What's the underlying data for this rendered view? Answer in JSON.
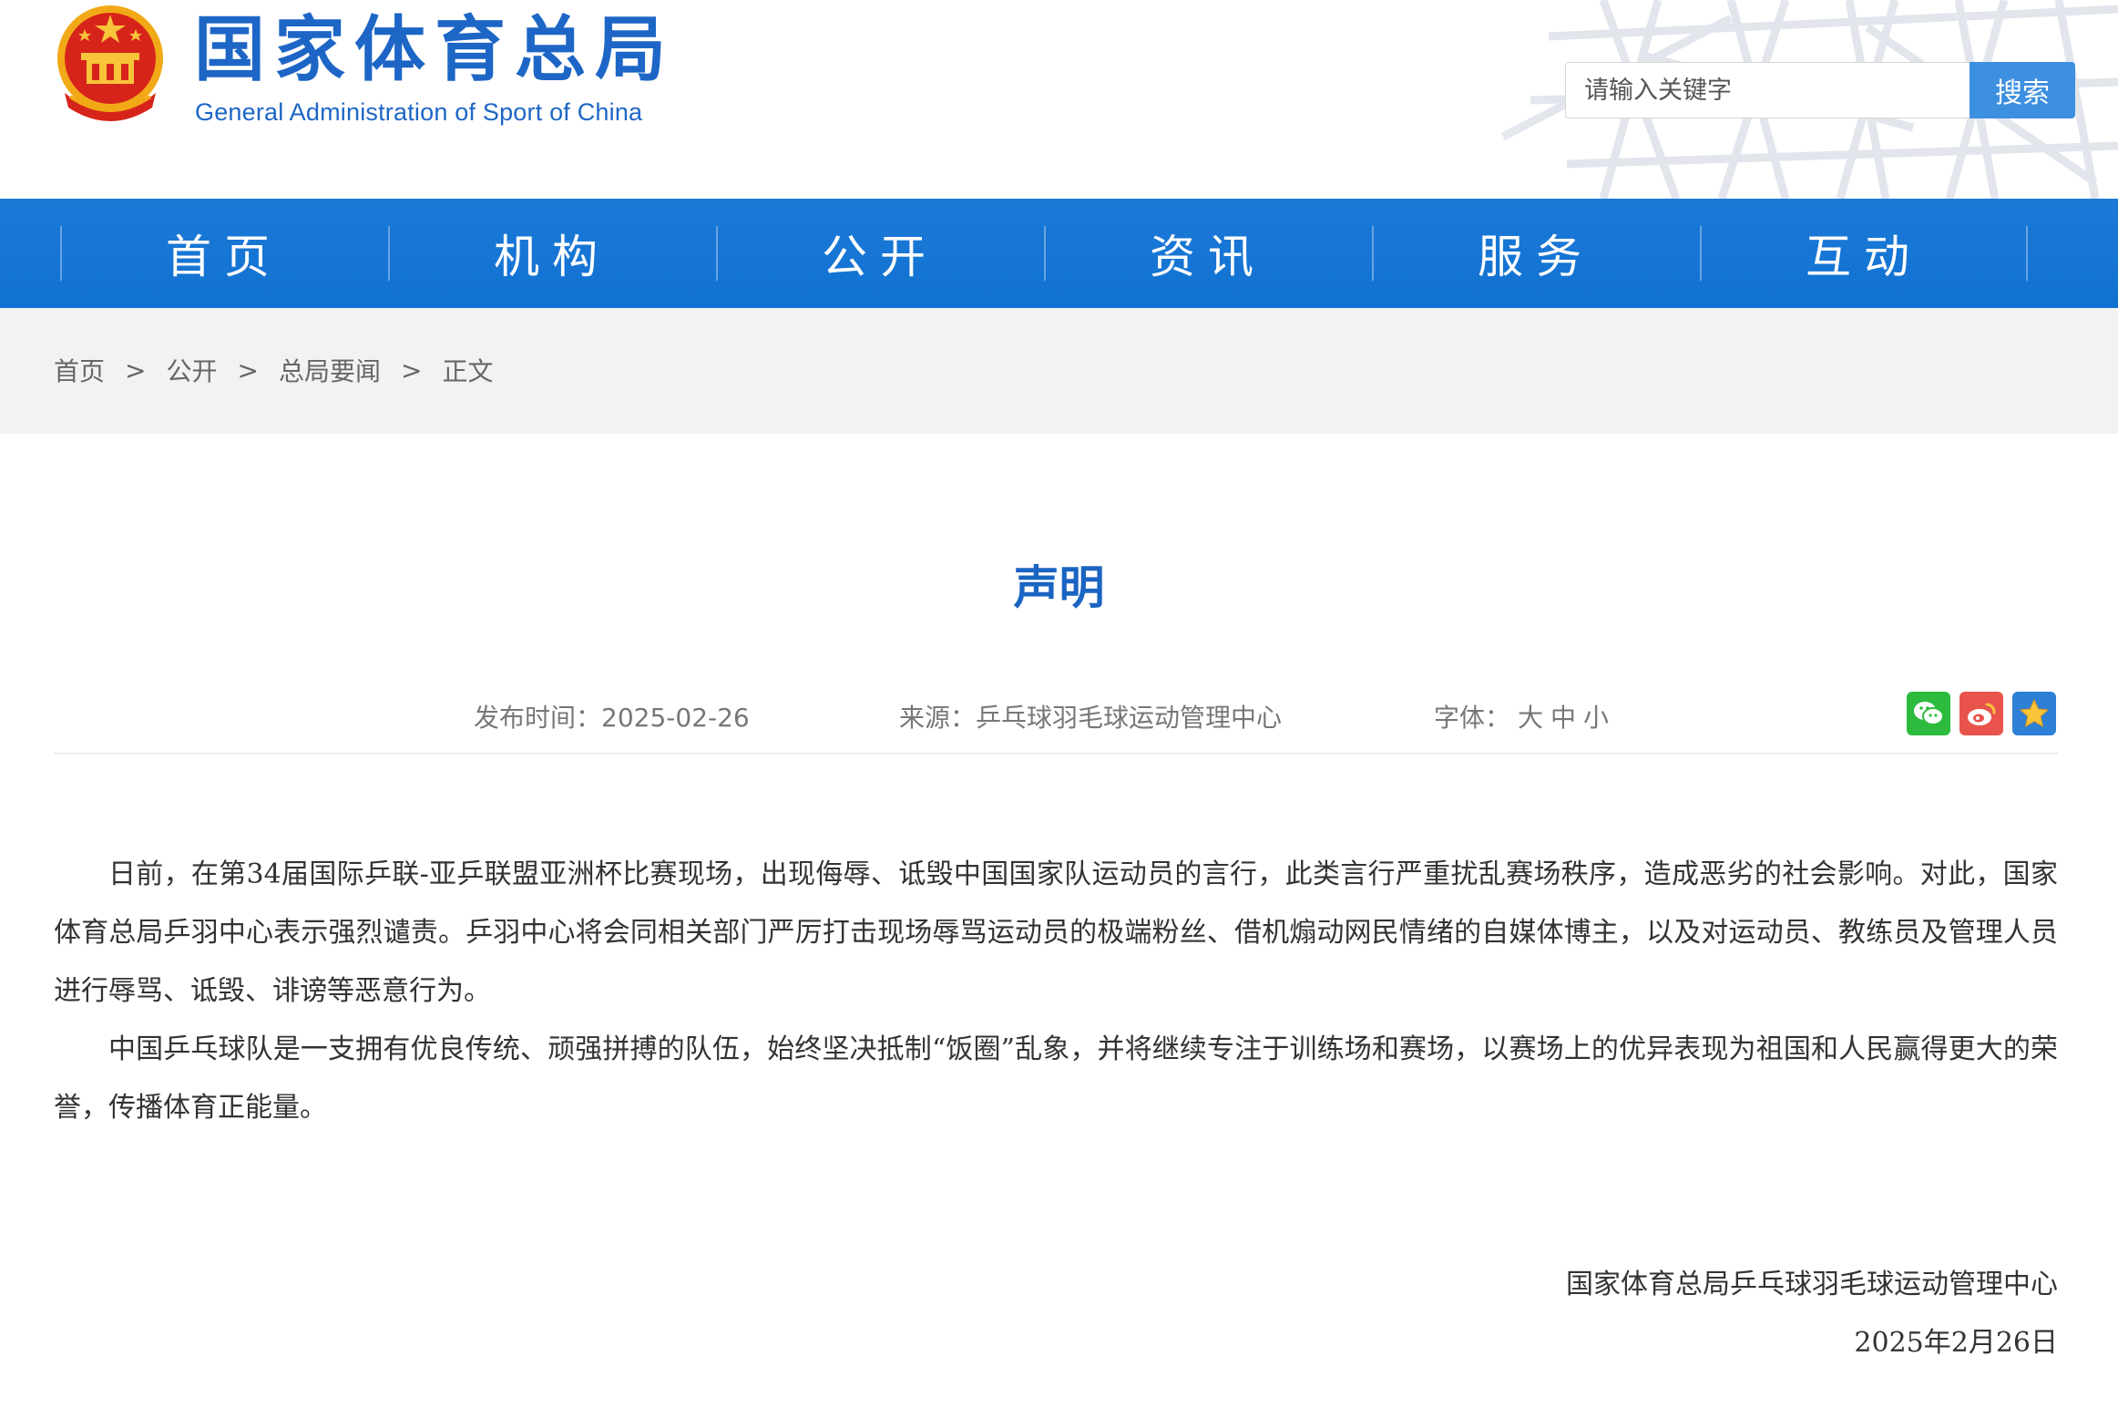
{
  "header": {
    "title": "国家体育总局",
    "subtitle": "General Administration of Sport of China",
    "emblem_icon": "national-emblem-icon",
    "search": {
      "placeholder": "请输入关键字",
      "value": "",
      "button_label": "搜索"
    }
  },
  "nav": {
    "items": [
      {
        "label": "首页"
      },
      {
        "label": "机构"
      },
      {
        "label": "公开"
      },
      {
        "label": "资讯"
      },
      {
        "label": "服务"
      },
      {
        "label": "互动"
      }
    ]
  },
  "breadcrumb": {
    "items": [
      "首页",
      "公开",
      "总局要闻",
      "正文"
    ],
    "separator": ">"
  },
  "article": {
    "title": "声明",
    "publish_label": "发布时间：",
    "publish_date": "2025-02-26",
    "source_label": "来源：",
    "source": "乒乓球羽毛球运动管理中心",
    "font_label": "字体：",
    "font_sizes": [
      "大",
      "中",
      "小"
    ],
    "share_icons": [
      "wechat-share-icon",
      "weibo-share-icon",
      "favorite-star-icon"
    ],
    "paragraphs": [
      "日前，在第34届国际乒联-亚乒联盟亚洲杯比赛现场，出现侮辱、诋毁中国国家队运动员的言行，此类言行严重扰乱赛场秩序，造成恶劣的社会影响。对此，国家体育总局乒羽中心表示强烈谴责。乒羽中心将会同相关部门严厉打击现场辱骂运动员的极端粉丝、借机煽动网民情绪的自媒体博主，以及对运动员、教练员及管理人员进行辱骂、诋毁、诽谤等恶意行为。",
      "中国乒乓球队是一支拥有优良传统、顽强拼搏的队伍，始终坚决抵制“饭圈”乱象，并将继续专注于训练场和赛场，以赛场上的优异表现为祖国和人民赢得更大的荣誉，传播体育正能量。"
    ],
    "signature_org": "国家体育总局乒乓球羽毛球运动管理中心",
    "signature_date": "2025年2月26日"
  },
  "colors": {
    "brand_blue": "#1d66c6",
    "nav_blue": "#1776d5",
    "search_button": "#3d8fe0",
    "title_blue": "#1a64c2",
    "breadcrumb_bg": "#f2f2f2"
  }
}
